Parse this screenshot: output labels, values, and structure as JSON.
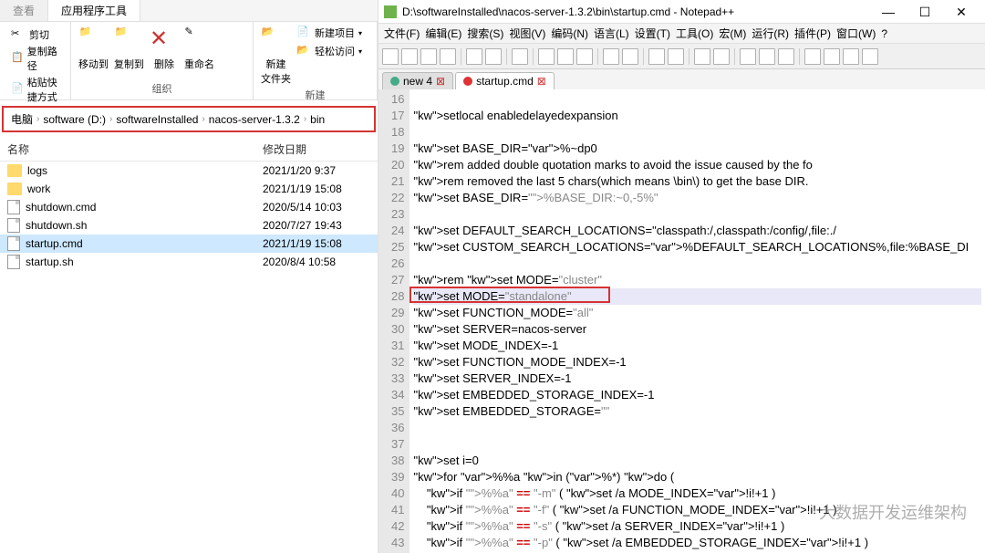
{
  "explorer": {
    "tabs": {
      "view": "查看",
      "tools": "应用程序工具"
    },
    "ribbon": {
      "left": {
        "cut": "剪切",
        "copy_path": "复制路径",
        "paste_shortcut": "粘贴快捷方式"
      },
      "org": {
        "move": "移动到",
        "copy": "复制到",
        "delete": "删除",
        "rename": "重命名",
        "group_label": "组织"
      },
      "new": {
        "new_folder": "新建\n文件夹",
        "new_item": "新建项目",
        "easy_access": "轻松访问",
        "group_label": "新建"
      }
    },
    "breadcrumb": [
      "电脑",
      "software (D:)",
      "softwareInstalled",
      "nacos-server-1.3.2",
      "bin"
    ],
    "columns": {
      "name": "名称",
      "date": "修改日期"
    },
    "files": [
      {
        "name": "logs",
        "type": "folder",
        "date": "2021/1/20 9:37"
      },
      {
        "name": "work",
        "type": "folder",
        "date": "2021/1/19 15:08"
      },
      {
        "name": "shutdown.cmd",
        "type": "file",
        "date": "2020/5/14 10:03"
      },
      {
        "name": "shutdown.sh",
        "type": "file",
        "date": "2020/7/27 19:43"
      },
      {
        "name": "startup.cmd",
        "type": "file",
        "date": "2021/1/19 15:08",
        "selected": true
      },
      {
        "name": "startup.sh",
        "type": "file",
        "date": "2020/8/4 10:58"
      }
    ]
  },
  "npp": {
    "title": "D:\\softwareInstalled\\nacos-server-1.3.2\\bin\\startup.cmd - Notepad++",
    "menu": [
      "文件(F)",
      "编辑(E)",
      "搜索(S)",
      "视图(V)",
      "编码(N)",
      "语言(L)",
      "设置(T)",
      "工具(O)",
      "宏(M)",
      "运行(R)",
      "插件(P)",
      "窗口(W)",
      "?"
    ],
    "tabs": [
      {
        "label": "new 4",
        "active": false
      },
      {
        "label": "startup.cmd",
        "active": true
      }
    ],
    "first_line": 16,
    "code": [
      "",
      "setlocal enabledelayedexpansion",
      "",
      "set BASE_DIR=%~dp0",
      "rem added double quotation marks to avoid the issue caused by the fo",
      "rem removed the last 5 chars(which means \\bin\\) to get the base DIR.",
      "set BASE_DIR=\"%BASE_DIR:~0,-5%\"",
      "",
      "set DEFAULT_SEARCH_LOCATIONS=\"classpath:/,classpath:/config/,file:./",
      "set CUSTOM_SEARCH_LOCATIONS=%DEFAULT_SEARCH_LOCATIONS%,file:%BASE_DI",
      "",
      "rem set MODE=\"cluster\"",
      "set MODE=\"standalone\"",
      "set FUNCTION_MODE=\"all\"",
      "set SERVER=nacos-server",
      "set MODE_INDEX=-1",
      "set FUNCTION_MODE_INDEX=-1",
      "set SERVER_INDEX=-1",
      "set EMBEDDED_STORAGE_INDEX=-1",
      "set EMBEDDED_STORAGE=\"\"",
      "",
      "",
      "set i=0",
      "for %%a in (%*) do (",
      "    if \"%%a\" == \"-m\" ( set /a MODE_INDEX=!i!+1 )",
      "    if \"%%a\" == \"-f\" ( set /a FUNCTION_MODE_INDEX=!i!+1 )",
      "    if \"%%a\" == \"-s\" ( set /a SERVER_INDEX=!i!+1 )",
      "    if \"%%a\" == \"-p\" ( set /a EMBEDDED_STORAGE_INDEX=!i!+1 )"
    ],
    "highlight_line_index": 12
  },
  "watermark": "大数据开发运维架构"
}
